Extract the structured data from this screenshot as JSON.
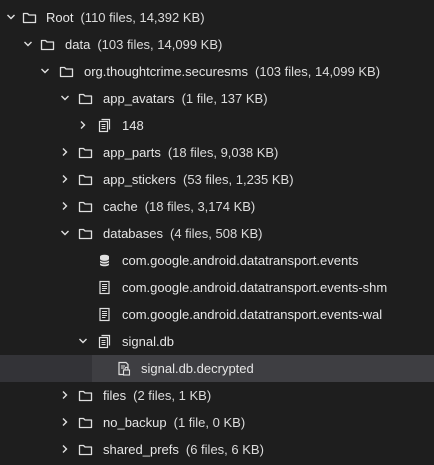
{
  "tree": {
    "rows": [
      {
        "name": "Root",
        "meta": "(110 files, 14,392 KB)",
        "icon": "folder-icon",
        "expanded": true
      },
      {
        "name": "data",
        "meta": "(103 files, 14,099 KB)",
        "icon": "folder-icon",
        "expanded": true
      },
      {
        "name": "org.thoughtcrime.securesms",
        "meta": "(103 files, 14,099 KB)",
        "icon": "folder-icon",
        "expanded": true
      },
      {
        "name": "app_avatars",
        "meta": "(1 file, 137 KB)",
        "icon": "folder-icon",
        "expanded": true
      },
      {
        "name": "148",
        "meta": "",
        "icon": "files-icon",
        "expanded": false
      },
      {
        "name": "app_parts",
        "meta": "(18 files, 9,038 KB)",
        "icon": "folder-icon",
        "expanded": false
      },
      {
        "name": "app_stickers",
        "meta": "(53 files, 1,235 KB)",
        "icon": "folder-icon",
        "expanded": false
      },
      {
        "name": "cache",
        "meta": "(18 files, 3,174 KB)",
        "icon": "folder-icon",
        "expanded": false
      },
      {
        "name": "databases",
        "meta": "(4 files, 508 KB)",
        "icon": "folder-icon",
        "expanded": true
      },
      {
        "name": "com.google.android.datatransport.events",
        "meta": "",
        "icon": "database-icon"
      },
      {
        "name": "com.google.android.datatransport.events-shm",
        "meta": "",
        "icon": "document-icon"
      },
      {
        "name": "com.google.android.datatransport.events-wal",
        "meta": "",
        "icon": "document-icon"
      },
      {
        "name": "signal.db",
        "meta": "",
        "icon": "files-icon",
        "expanded": true
      },
      {
        "name": "signal.db.decrypted",
        "meta": "",
        "icon": "decrypted-file-icon",
        "selected": true
      },
      {
        "name": "files",
        "meta": "(2 files, 1 KB)",
        "icon": "folder-icon",
        "expanded": false
      },
      {
        "name": "no_backup",
        "meta": "(1 file, 0 KB)",
        "icon": "folder-icon",
        "expanded": false
      },
      {
        "name": "shared_prefs",
        "meta": "(6 files, 6 KB)",
        "icon": "folder-icon",
        "expanded": false
      }
    ]
  },
  "colors": {
    "background": "#1e1e1e",
    "text": "#dcdcdc",
    "icon": "#e0e0e0",
    "selection": "#3e3e42"
  }
}
